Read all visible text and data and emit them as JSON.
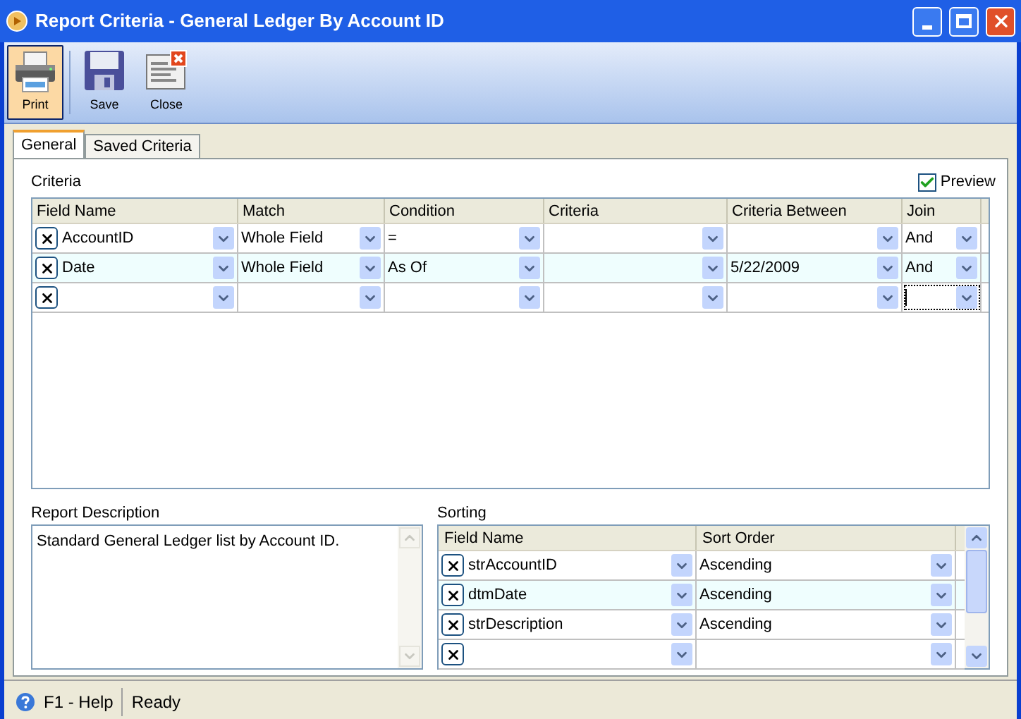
{
  "window": {
    "title": "Report Criteria - General Ledger By Account ID"
  },
  "toolbar": [
    {
      "kind": "print",
      "label": "Print",
      "selected": true
    },
    {
      "kind": "save",
      "label": "Save",
      "selected": false
    },
    {
      "kind": "close",
      "label": "Close",
      "selected": false
    }
  ],
  "tabs": [
    {
      "label": "General",
      "selected": true
    },
    {
      "label": "Saved Criteria",
      "selected": false
    }
  ],
  "criteria": {
    "label": "Criteria",
    "preview": {
      "label": "Preview",
      "checked": true
    },
    "columns": [
      "Field Name",
      "Match",
      "Condition",
      "Criteria",
      "Criteria Between",
      "Join"
    ],
    "rows": [
      {
        "cells": [
          {
            "text": "AccountID",
            "focused": false
          },
          {
            "text": "Whole Field",
            "focused": false
          },
          {
            "text": "=",
            "focused": false
          },
          {
            "focused": false
          },
          {
            "focused": false
          },
          {
            "text": "And",
            "focused": false
          }
        ]
      },
      {
        "cells": [
          {
            "text": "Date",
            "focused": false
          },
          {
            "text": "Whole Field",
            "focused": false
          },
          {
            "text": "As Of",
            "focused": false
          },
          {
            "focused": false
          },
          {
            "text": "5/22/2009",
            "focused": false
          },
          {
            "text": "And",
            "focused": false
          }
        ]
      },
      {
        "cells": [
          {
            "focused": false
          },
          {
            "focused": false
          },
          {
            "focused": false
          },
          {
            "focused": false
          },
          {
            "focused": false
          },
          {
            "focused": true
          }
        ]
      }
    ]
  },
  "description": {
    "label": "Report Description",
    "value": "Standard General Ledger list by Account ID."
  },
  "sorting": {
    "label": "Sorting",
    "columns": [
      "Field Name",
      "Sort Order"
    ],
    "rows": [
      {
        "cells": [
          "strAccountID",
          "Ascending"
        ]
      },
      {
        "cells": [
          "dtmDate",
          "Ascending"
        ]
      },
      {
        "cells": [
          "strDescription",
          "Ascending"
        ]
      },
      {
        "cells": []
      }
    ]
  },
  "status_bar": {
    "help": "F1 - Help",
    "status": "Ready"
  }
}
